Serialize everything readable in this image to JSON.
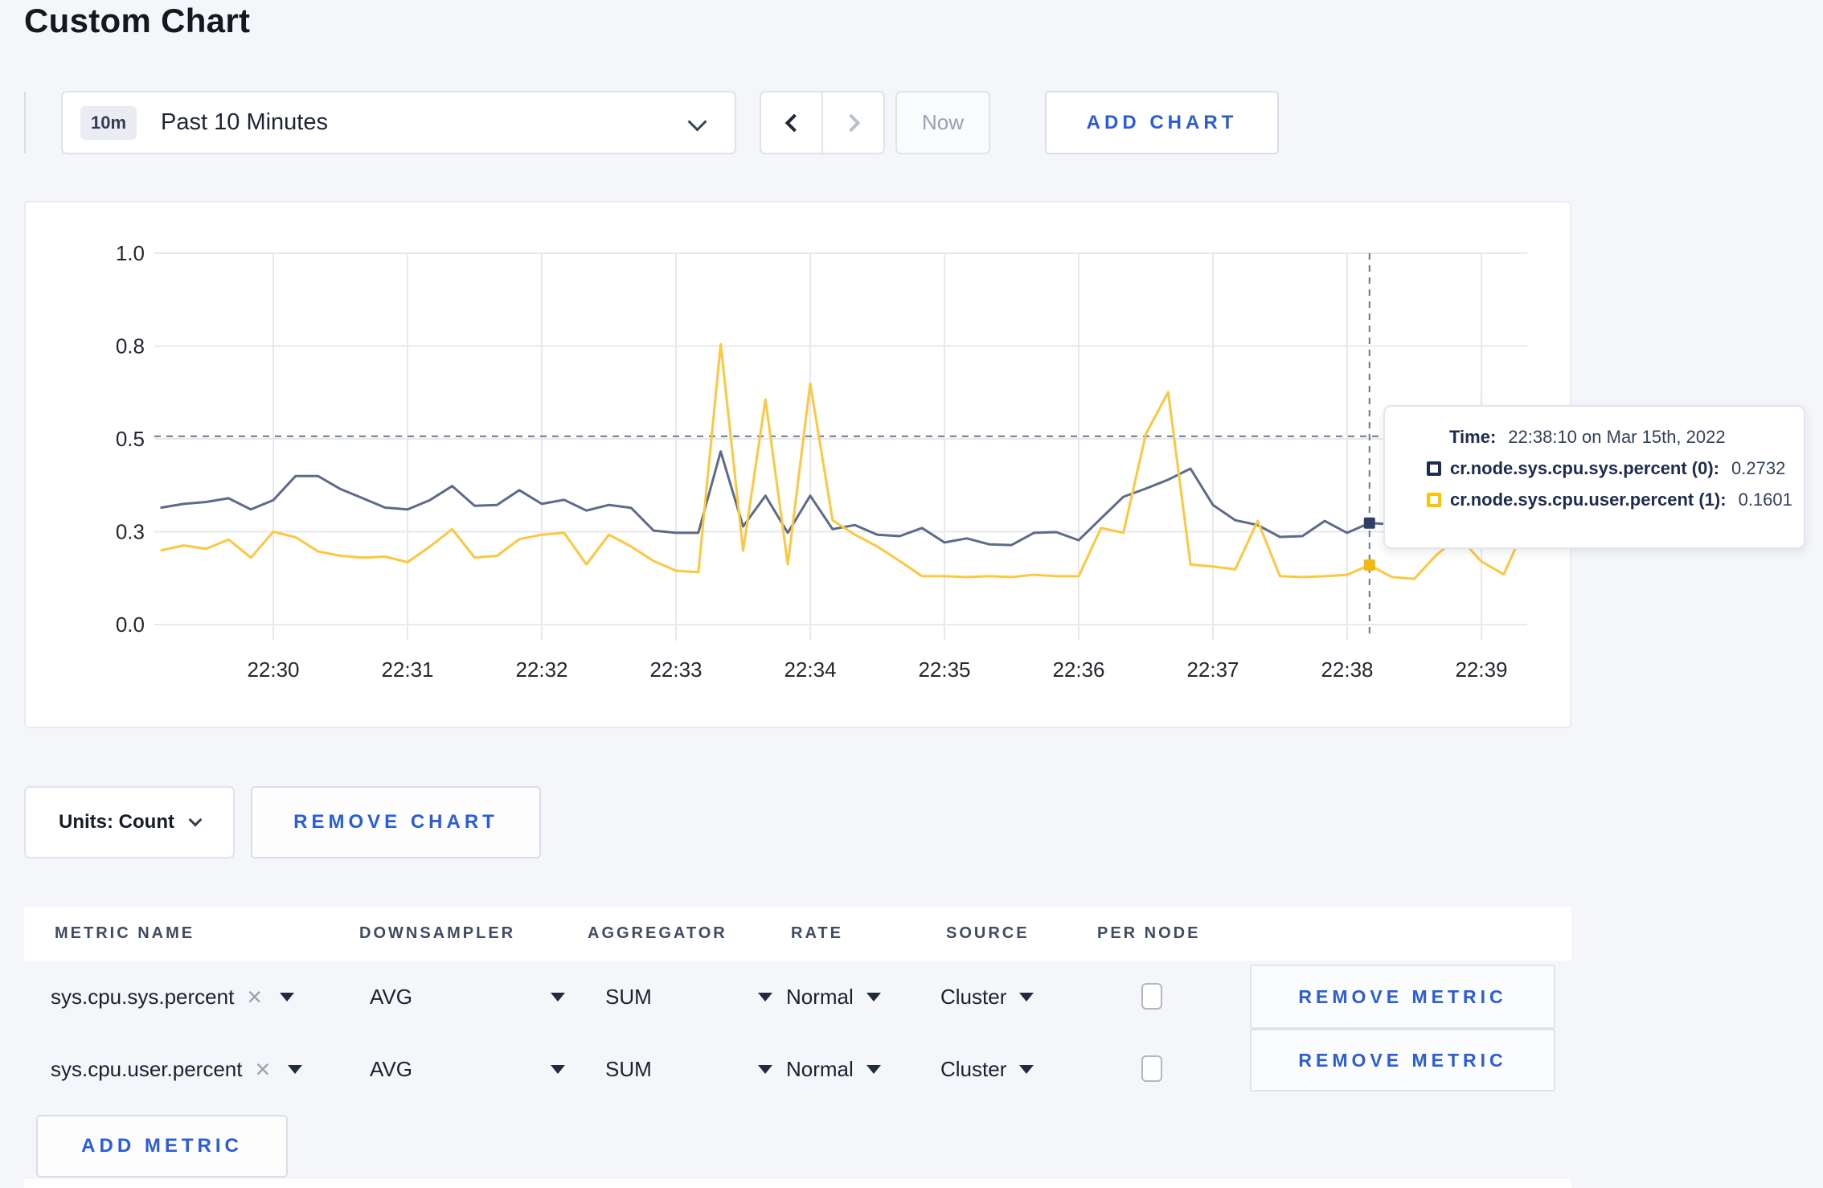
{
  "page": {
    "title": "Custom Chart",
    "background": "#f4f6fa",
    "accent_blue": "#2b5cd9",
    "card_border": "#e9ebf2"
  },
  "toolbar": {
    "time_scale_badge": "10m",
    "time_scale_label": "Past 10 Minutes",
    "now_label": "Now",
    "add_chart_label": "ADD CHART"
  },
  "chart_data": {
    "type": "line",
    "title": "",
    "x_start_time": "22:29:10",
    "x_interval_seconds": 10,
    "x_tick_labels": [
      "22:30",
      "22:31",
      "22:32",
      "22:33",
      "22:34",
      "22:35",
      "22:36",
      "22:37",
      "22:38",
      "22:39"
    ],
    "y_tick_labels": [
      "0.0",
      "0.3",
      "0.5",
      "0.8",
      "1.0"
    ],
    "y_tick_values": [
      0,
      0.25,
      0.5,
      0.75,
      1.0
    ],
    "ylim": [
      0,
      1
    ],
    "grid": true,
    "legend_position": "none",
    "series": [
      {
        "name": "cr.node.sys.cpu.sys.percent",
        "color": "#5d6b89",
        "marker_color": "#2e3f63",
        "values": [
          0.315,
          0.325,
          0.33,
          0.34,
          0.31,
          0.335,
          0.4,
          0.4,
          0.365,
          0.34,
          0.315,
          0.31,
          0.335,
          0.373,
          0.32,
          0.322,
          0.362,
          0.325,
          0.336,
          0.307,
          0.322,
          0.314,
          0.253,
          0.247,
          0.247,
          0.466,
          0.264,
          0.347,
          0.247,
          0.347,
          0.257,
          0.268,
          0.242,
          0.238,
          0.26,
          0.221,
          0.232,
          0.216,
          0.214,
          0.247,
          0.249,
          0.227,
          0.286,
          0.344,
          0.366,
          0.39,
          0.42,
          0.322,
          0.281,
          0.268,
          0.236,
          0.238,
          0.279,
          0.247,
          0.2732,
          0.27,
          0.26,
          0.28,
          0.27,
          0.3,
          0.29,
          0.3
        ]
      },
      {
        "name": "cr.node.sys.cpu.user.percent",
        "color": "#fdc73f",
        "marker_color": "#f5b80e",
        "values": [
          0.2,
          0.213,
          0.204,
          0.229,
          0.18,
          0.25,
          0.235,
          0.197,
          0.185,
          0.18,
          0.183,
          0.168,
          0.21,
          0.257,
          0.18,
          0.185,
          0.23,
          0.242,
          0.247,
          0.162,
          0.242,
          0.21,
          0.171,
          0.145,
          0.141,
          0.755,
          0.199,
          0.606,
          0.162,
          0.649,
          0.281,
          0.242,
          0.21,
          0.171,
          0.13,
          0.13,
          0.128,
          0.13,
          0.128,
          0.134,
          0.13,
          0.13,
          0.26,
          0.247,
          0.513,
          0.626,
          0.162,
          0.156,
          0.149,
          0.279,
          0.13,
          0.128,
          0.13,
          0.134,
          0.1601,
          0.128,
          0.123,
          0.188,
          0.236,
          0.17,
          0.135,
          0.27
        ]
      }
    ],
    "crosshair": {
      "index": 54,
      "time": "22:38:10",
      "y_value": 0.507,
      "color": "#64788f"
    }
  },
  "tooltip": {
    "time_label": "Time:",
    "time_value": "22:38:10 on Mar 15th, 2022",
    "series": [
      {
        "label": "cr.node.sys.cpu.sys.percent (0):",
        "value": "0.2732",
        "color": "#1d2d55"
      },
      {
        "label": "cr.node.sys.cpu.user.percent (1):",
        "value": "0.1601",
        "color": "#fdc500"
      }
    ]
  },
  "chart_controls": {
    "units_label": "Units: Count",
    "remove_chart_label": "REMOVE CHART"
  },
  "metrics_table": {
    "headers": [
      "METRIC NAME",
      "DOWNSAMPLER",
      "AGGREGATOR",
      "RATE",
      "SOURCE",
      "PER NODE"
    ],
    "rows": [
      {
        "metric": "sys.cpu.sys.percent",
        "downsampler": "AVG",
        "aggregator": "SUM",
        "rate": "Normal",
        "source": "Cluster",
        "per_node_checked": false,
        "remove_label": "REMOVE METRIC"
      },
      {
        "metric": "sys.cpu.user.percent",
        "downsampler": "AVG",
        "aggregator": "SUM",
        "rate": "Normal",
        "source": "Cluster",
        "per_node_checked": false,
        "remove_label": "REMOVE METRIC"
      }
    ],
    "add_metric_label": "ADD METRIC"
  }
}
